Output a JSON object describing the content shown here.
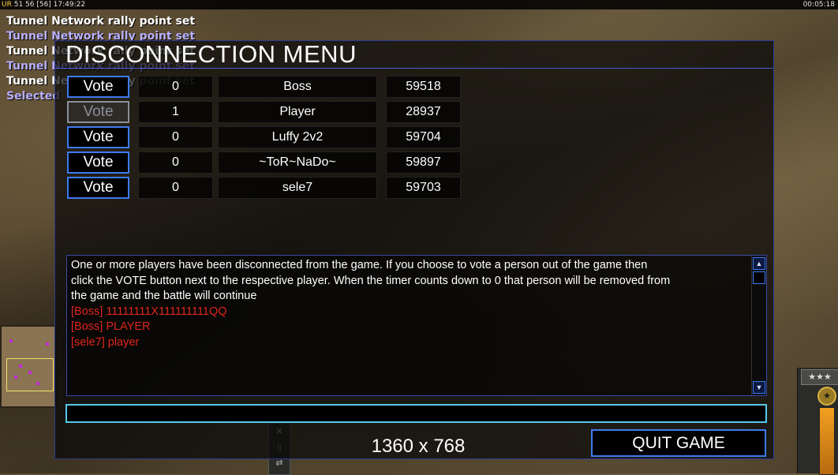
{
  "hud": {
    "top_left_prefix": "UR",
    "top_left_text": "51 56 [56] 17:49:22",
    "top_right_text": "00:05:18"
  },
  "chat_log": [
    {
      "text": "Tunnel Network rally point set",
      "color": "white"
    },
    {
      "text": "Tunnel Network rally point set",
      "color": "lavender"
    },
    {
      "text": "Tunnel Network rally point set",
      "color": "white"
    },
    {
      "text": "Tunnel Network rally point set",
      "color": "lavender"
    },
    {
      "text": "Tunnel Network rally point set",
      "color": "white"
    },
    {
      "text": "Selected",
      "color": "lavender"
    }
  ],
  "dialog": {
    "title": "DISCONNECTION MENU",
    "vote_label": "Vote",
    "players": [
      {
        "votes": "0",
        "name": "Boss",
        "ping": "59518",
        "vote_enabled": true
      },
      {
        "votes": "1",
        "name": "Player",
        "ping": "28937",
        "vote_enabled": false
      },
      {
        "votes": "0",
        "name": "Luffy 2v2",
        "ping": "59704",
        "vote_enabled": true
      },
      {
        "votes": "0",
        "name": "~ToR~NaDo~",
        "ping": "59897",
        "vote_enabled": true
      },
      {
        "votes": "0",
        "name": "sele7",
        "ping": "59703",
        "vote_enabled": true
      }
    ],
    "message_lines": [
      "One or more players have been disconnected from the game. If you choose to vote a person out of the game then",
      " click the VOTE button next to the respective player. When the timer counts down to 0 that person will be removed from",
      " the game and the battle will continue"
    ],
    "chat_messages": [
      "[Boss] 11111111X111111111QQ",
      "[Boss] PLAYER",
      "[sele7] player"
    ],
    "chat_input_value": "",
    "resolution_text": "1360 x 768",
    "quit_label": "QUIT GAME"
  },
  "colors": {
    "accent_blue": "#3d7bf0",
    "input_cyan": "#56c9e8",
    "chat_red": "#e0241c"
  },
  "icons": {
    "scroll_up": "triangle-up-icon",
    "scroll_down": "triangle-down-icon",
    "rank": "star-icon"
  }
}
